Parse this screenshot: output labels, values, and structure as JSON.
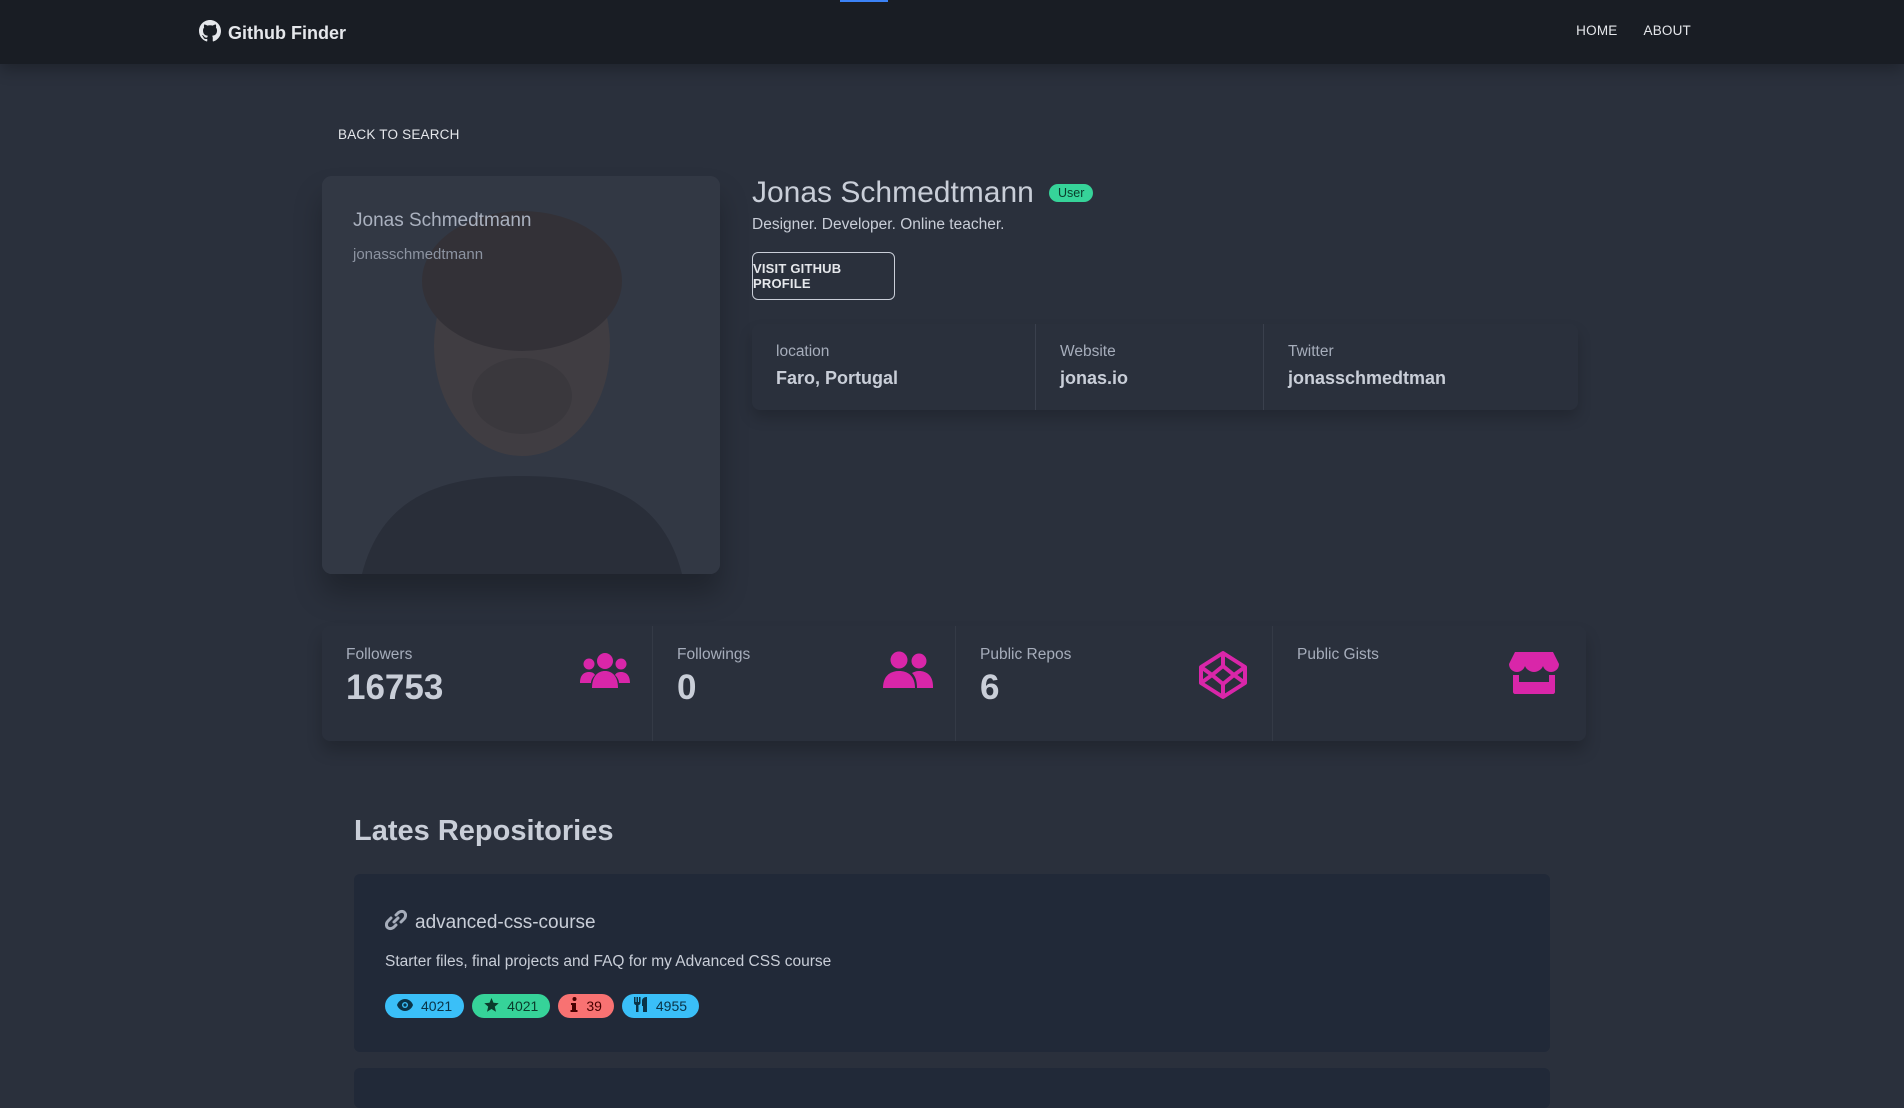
{
  "navbar": {
    "brand": "Github Finder",
    "links": [
      "HOME",
      "ABOUT"
    ]
  },
  "back_link": "BACK TO SEARCH",
  "profile": {
    "avatar_name": "Jonas Schmedtmann",
    "avatar_login": "jonasschmedtmann",
    "name": "Jonas Schmedtmann",
    "type_badge": "User",
    "bio": "Designer. Developer. Online teacher.",
    "visit_button": "VISIT GITHUB PROFILE",
    "details": [
      {
        "title": "location",
        "value": "Faro, Portugal"
      },
      {
        "title": "Website",
        "value": "jonas.io"
      },
      {
        "title": "Twitter",
        "value": "jonasschmedtman"
      }
    ]
  },
  "stats": [
    {
      "title": "Followers",
      "value": "16753",
      "icon": "users-icon"
    },
    {
      "title": "Followings",
      "value": "0",
      "icon": "user-friends-icon"
    },
    {
      "title": "Public Repos",
      "value": "6",
      "icon": "codepen-icon"
    },
    {
      "title": "Public Gists",
      "value": "",
      "icon": "store-icon"
    }
  ],
  "repos": {
    "heading": "Lates Repositories",
    "items": [
      {
        "name": "advanced-css-course",
        "description": "Starter files, final projects and FAQ for my Advanced CSS course",
        "watchers": "4021",
        "stars": "4021",
        "issues": "39",
        "forks": "4955"
      }
    ]
  },
  "colors": {
    "background": "#2a303c",
    "navbar": "#191d24",
    "accent_icons": "#d926a9",
    "badge_info": "#3abff8",
    "badge_success": "#36d399",
    "badge_error": "#f87272"
  }
}
